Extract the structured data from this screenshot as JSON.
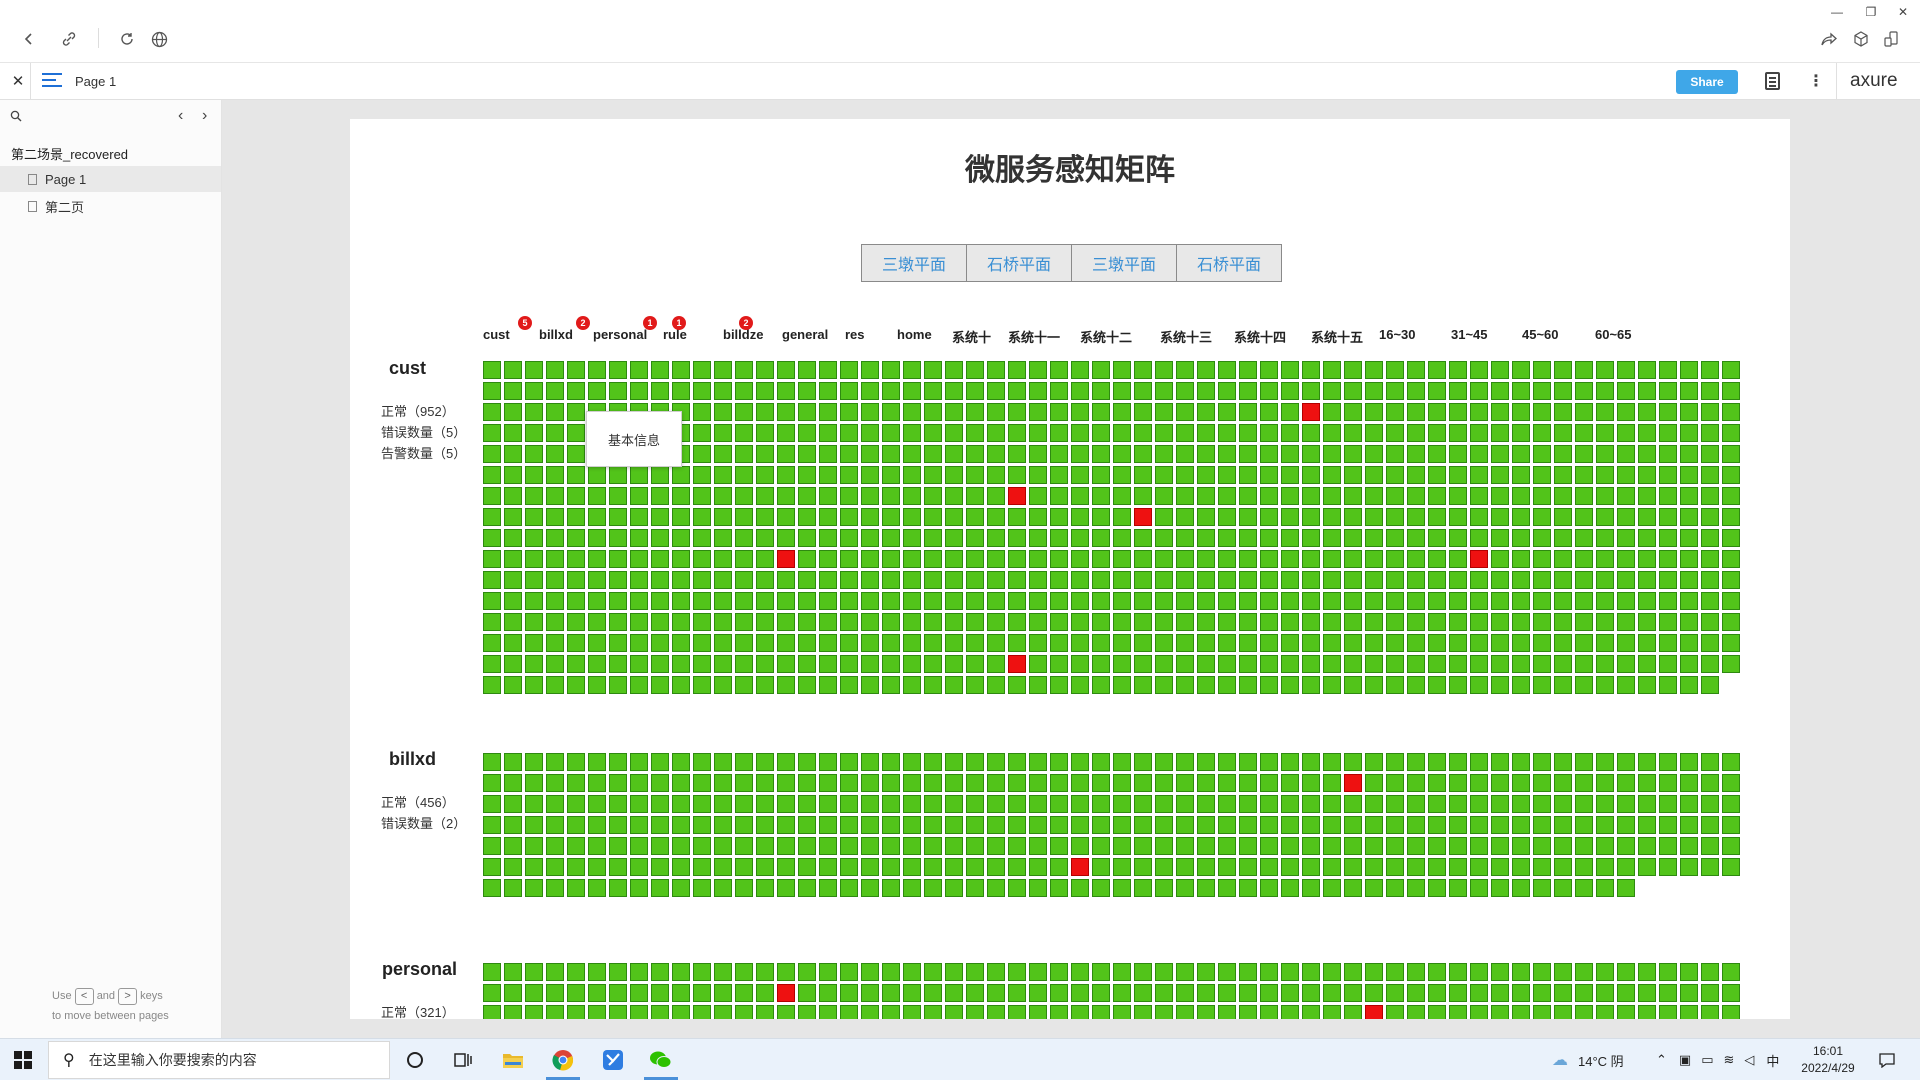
{
  "browser": {
    "window_controls": {
      "minimize": "—",
      "restore": "❐",
      "close": "✕"
    }
  },
  "toolbar": {
    "close_glyph": "✕",
    "page_name": "Page 1",
    "share_label": "Share",
    "logo": "axure",
    "more_glyph": "⋮"
  },
  "sidebar": {
    "project": "第二场景_recovered",
    "pages": [
      {
        "label": "Page 1",
        "active": true
      },
      {
        "label": "第二页",
        "active": false
      }
    ],
    "hint_use": "Use",
    "hint_and": "and",
    "hint_keys": "keys",
    "hint_line2": "to move between pages",
    "key_prev": "<",
    "key_next": ">"
  },
  "main": {
    "title": "微服务感知矩阵",
    "tabs": [
      "三墩平面",
      "石桥平面",
      "三墩平面",
      "石桥平面"
    ],
    "column_headers": [
      {
        "label": "cust",
        "badge": "5"
      },
      {
        "label": "billxd",
        "badge": "2"
      },
      {
        "label": "personal",
        "badge": "1"
      },
      {
        "label": "rule",
        "badge": "1"
      },
      {
        "label": "billdze",
        "badge": "2"
      },
      {
        "label": "general",
        "badge": ""
      },
      {
        "label": "res",
        "badge": ""
      },
      {
        "label": "home",
        "badge": ""
      },
      {
        "label": "系统十",
        "badge": ""
      },
      {
        "label": "系统十一",
        "badge": ""
      },
      {
        "label": "系统十二",
        "badge": ""
      },
      {
        "label": "系统十三",
        "badge": ""
      },
      {
        "label": "系统十四",
        "badge": ""
      },
      {
        "label": "系统十五",
        "badge": ""
      },
      {
        "label": "16~30",
        "badge": ""
      },
      {
        "label": "31~45",
        "badge": ""
      },
      {
        "label": "45~60",
        "badge": ""
      },
      {
        "label": "60~65",
        "badge": ""
      }
    ],
    "tooltip": "基本信息",
    "sections": [
      {
        "name": "cust",
        "stats": [
          "正常（952）",
          "错误数量（5）",
          "告警数量（5）"
        ],
        "cols": 60,
        "rows": 16,
        "last_row_count": 59,
        "errors": [
          [
            2,
            39
          ],
          [
            6,
            25
          ],
          [
            7,
            31
          ],
          [
            9,
            14
          ],
          [
            9,
            47
          ],
          [
            14,
            25
          ]
        ]
      },
      {
        "name": "billxd",
        "stats": [
          "正常（456）",
          "错误数量（2）"
        ],
        "cols": 60,
        "rows": 7,
        "last_row_count": 55,
        "errors": [
          [
            1,
            41
          ],
          [
            5,
            28
          ]
        ]
      },
      {
        "name": "personal",
        "stats": [
          "正常（321）"
        ],
        "cols": 60,
        "rows": 3,
        "last_row_count": 60,
        "errors": [
          [
            1,
            14
          ],
          [
            2,
            42
          ]
        ]
      }
    ]
  },
  "taskbar": {
    "search_placeholder": "在这里输入你要搜索的内容",
    "weather": "14°C  阴",
    "ime": "中",
    "time": "16:01",
    "date": "2022/4/29"
  }
}
